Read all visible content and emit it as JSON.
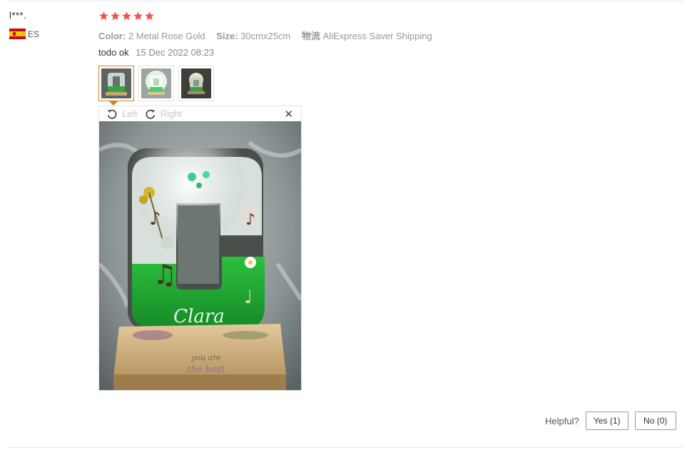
{
  "review": {
    "user_name": "l***.",
    "country_code": "ES",
    "rating": 5,
    "attributes": [
      {
        "key": "Color:",
        "value": "2 Metal Rose Gold"
      },
      {
        "key": "Size:",
        "value": "30cmx25cm"
      },
      {
        "key": "物流",
        "value": "AliExpress Saver Shipping"
      }
    ],
    "text": "todo ok",
    "date": "15 Dec 2022 08:23",
    "thumbnails": [
      {
        "icon": "photo-letter-c-dark",
        "active": true
      },
      {
        "icon": "photo-letter-c-lit",
        "active": false
      },
      {
        "icon": "photo-letter-c-lamp",
        "active": false
      }
    ],
    "viewer": {
      "rotate_left_label": "Left",
      "rotate_right_label": "Right",
      "photo_caption": "Clara",
      "photo_engraving_1": "you are",
      "photo_engraving_2": "the best"
    },
    "helpful": {
      "label": "Helpful?",
      "yes_label": "Yes (1)",
      "no_label": "No (0)"
    }
  },
  "colors": {
    "star": "#f5504a",
    "active_border": "#e07a20",
    "resin_green": "#1f9e2f"
  }
}
